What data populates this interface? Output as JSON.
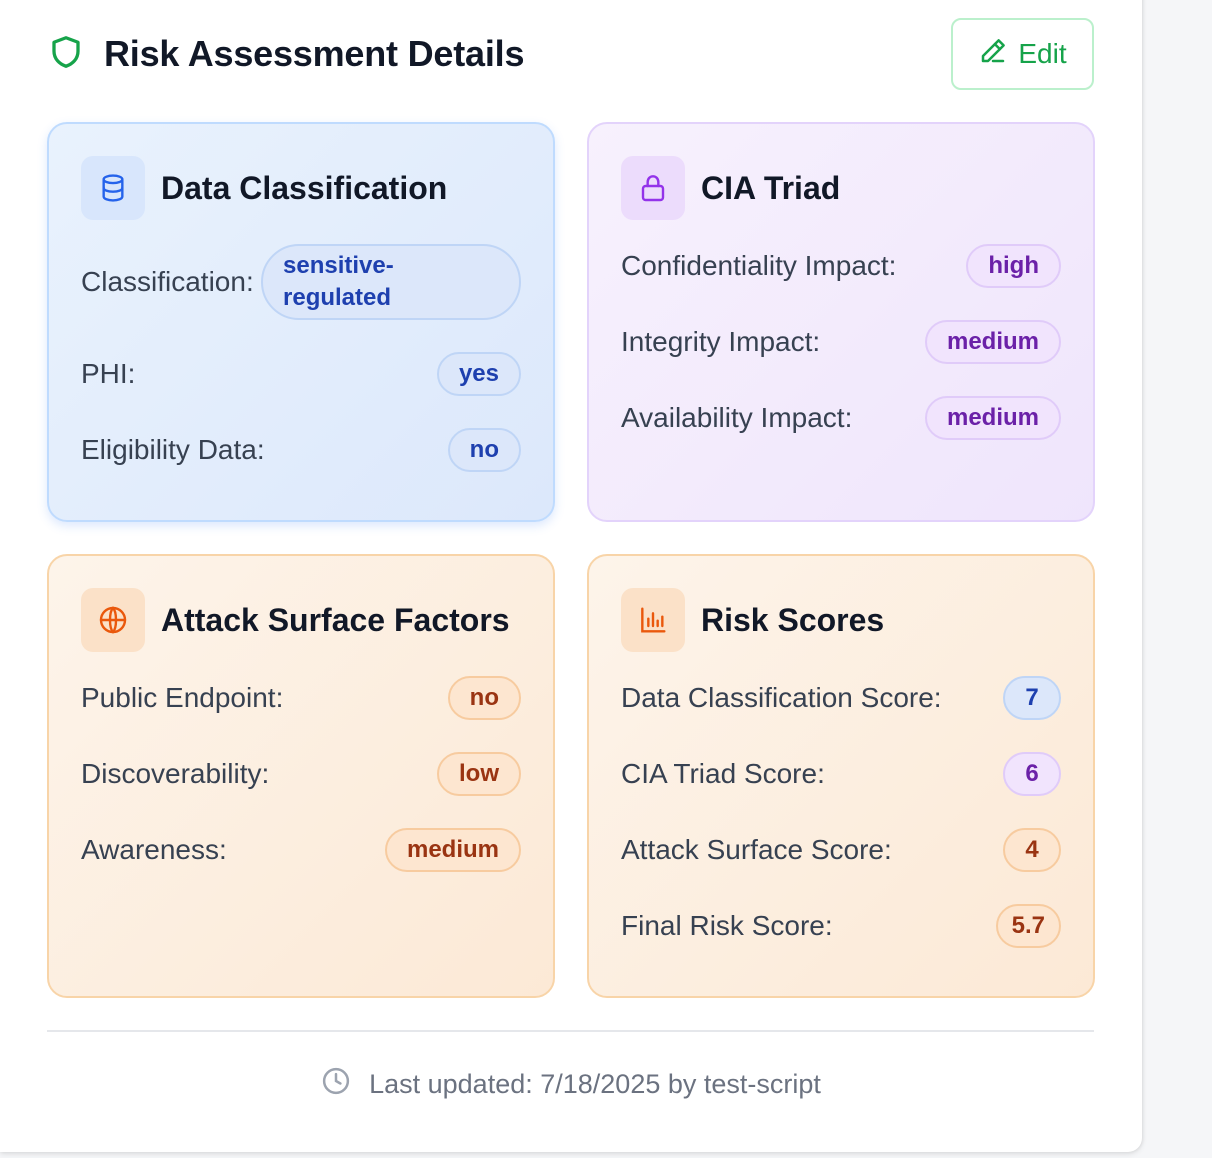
{
  "header": {
    "title": "Risk Assessment Details",
    "edit_label": "Edit",
    "icon": "shield-icon",
    "accent_color": "#16a34a"
  },
  "cards": {
    "data_classification": {
      "title": "Data Classification",
      "icon": "database-icon",
      "rows": [
        {
          "label": "Classification:",
          "value": "sensitive-regulated"
        },
        {
          "label": "PHI:",
          "value": "yes"
        },
        {
          "label": "Eligibility Data:",
          "value": "no"
        }
      ]
    },
    "cia_triad": {
      "title": "CIA Triad",
      "icon": "lock-icon",
      "rows": [
        {
          "label": "Confidentiality Impact:",
          "value": "high"
        },
        {
          "label": "Integrity Impact:",
          "value": "medium"
        },
        {
          "label": "Availability Impact:",
          "value": "medium"
        }
      ]
    },
    "attack_surface": {
      "title": "Attack Surface Factors",
      "icon": "globe-icon",
      "rows": [
        {
          "label": "Public Endpoint:",
          "value": "no"
        },
        {
          "label": "Discoverability:",
          "value": "low"
        },
        {
          "label": "Awareness:",
          "value": "medium"
        }
      ]
    },
    "risk_scores": {
      "title": "Risk Scores",
      "icon": "bar-chart-icon",
      "rows": [
        {
          "label": "Data Classification Score:",
          "value": "7"
        },
        {
          "label": "CIA Triad Score:",
          "value": "6"
        },
        {
          "label": "Attack Surface Score:",
          "value": "4"
        },
        {
          "label": "Final Risk Score:",
          "value": "5.7"
        }
      ]
    }
  },
  "footer": {
    "icon": "clock-icon",
    "text": "Last updated: 7/18/2025 by test-script"
  }
}
